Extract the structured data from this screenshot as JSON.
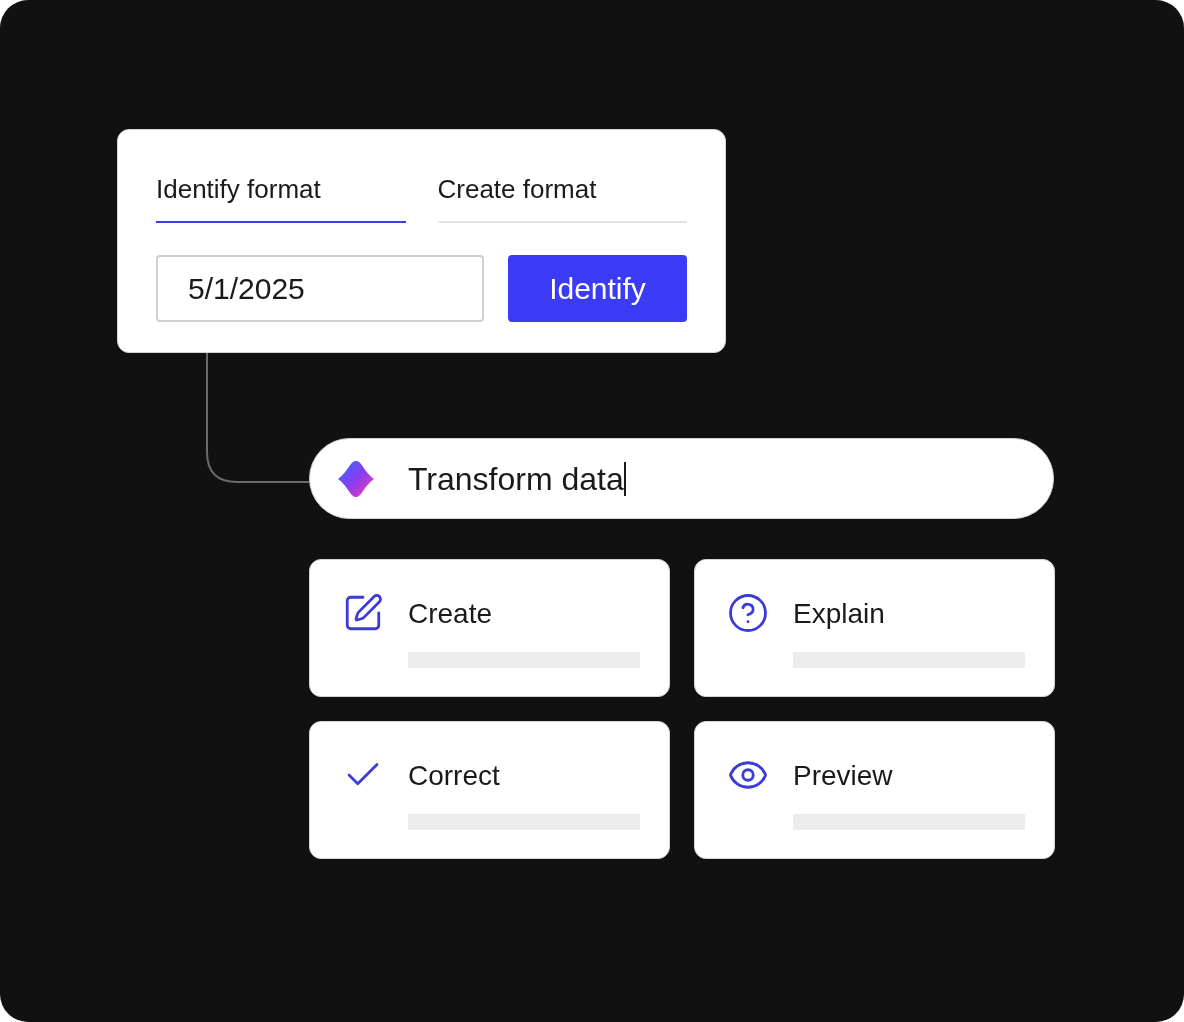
{
  "format_card": {
    "tabs": [
      {
        "label": "Identify format",
        "selected": true
      },
      {
        "label": "Create format",
        "selected": false
      }
    ],
    "date_field": {
      "value": "5/1/2025"
    },
    "button": "Identify"
  },
  "prompt": {
    "value": "Transform data",
    "focused": true
  },
  "actions": [
    {
      "label": "Create"
    },
    {
      "label": "Explain"
    },
    {
      "label": "Correct"
    },
    {
      "label": "Preview"
    }
  ]
}
